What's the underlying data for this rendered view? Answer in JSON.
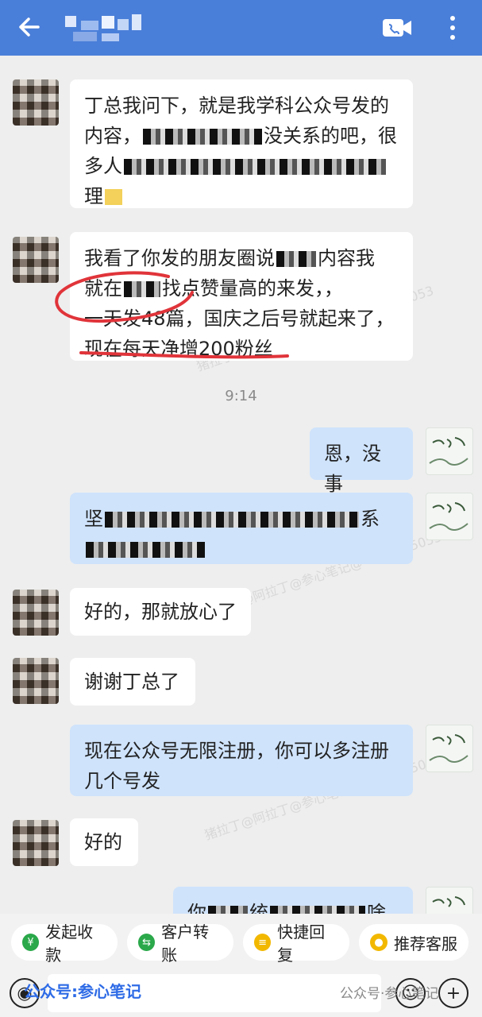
{
  "header": {
    "back_icon": "arrow-left-icon",
    "video_icon": "video-call-icon",
    "more_icon": "more-vertical-icon",
    "bg_color": "#4a7fd9"
  },
  "messages": {
    "m1": {
      "a": "丁总我问下，就是我学科公众号发的",
      "b": "内容，",
      "c": "没关系的吧，很",
      "d": "多人",
      "e": "理"
    },
    "m2": {
      "a": "我看了你发的朋友圈说",
      "b": "内容我",
      "c": "就在",
      "d": "找点赞量高的来发，，",
      "e": "一天发48篇，国庆之后号就起来了，",
      "f": "现在每天净增200粉丝"
    },
    "time": "9:14",
    "m3": "恩，没事",
    "m4": {
      "a": "坚",
      "b": "系"
    },
    "m5": "好的，那就放心了",
    "m6": "谢谢丁总了",
    "m7": "现在公众号无限注册，你可以多注册\n几个号发",
    "m8": "好的",
    "m9": {
      "a": "你",
      "b": "统",
      "c": "啥"
    }
  },
  "watermark_text": "猪拉丁@阿拉丁@参心笔记@一条鸿鹄5053",
  "quick_replies": [
    {
      "label": "发起收款",
      "icon": "yen-icon",
      "color": "#2aa84a"
    },
    {
      "label": "客户转账",
      "icon": "transfer-icon",
      "color": "#2aa84a"
    },
    {
      "label": "快捷回复",
      "icon": "quick-reply-icon",
      "color": "#f2b800"
    },
    {
      "label": "推荐客服",
      "icon": "service-icon",
      "color": "#f2b800"
    }
  ],
  "input": {
    "overlay_left": "公众号:参心笔记",
    "overlay_right": "公众号·参心笔记",
    "voice_icon": "voice-icon",
    "emoji_icon": "emoji-icon",
    "plus_icon": "plus-icon"
  }
}
